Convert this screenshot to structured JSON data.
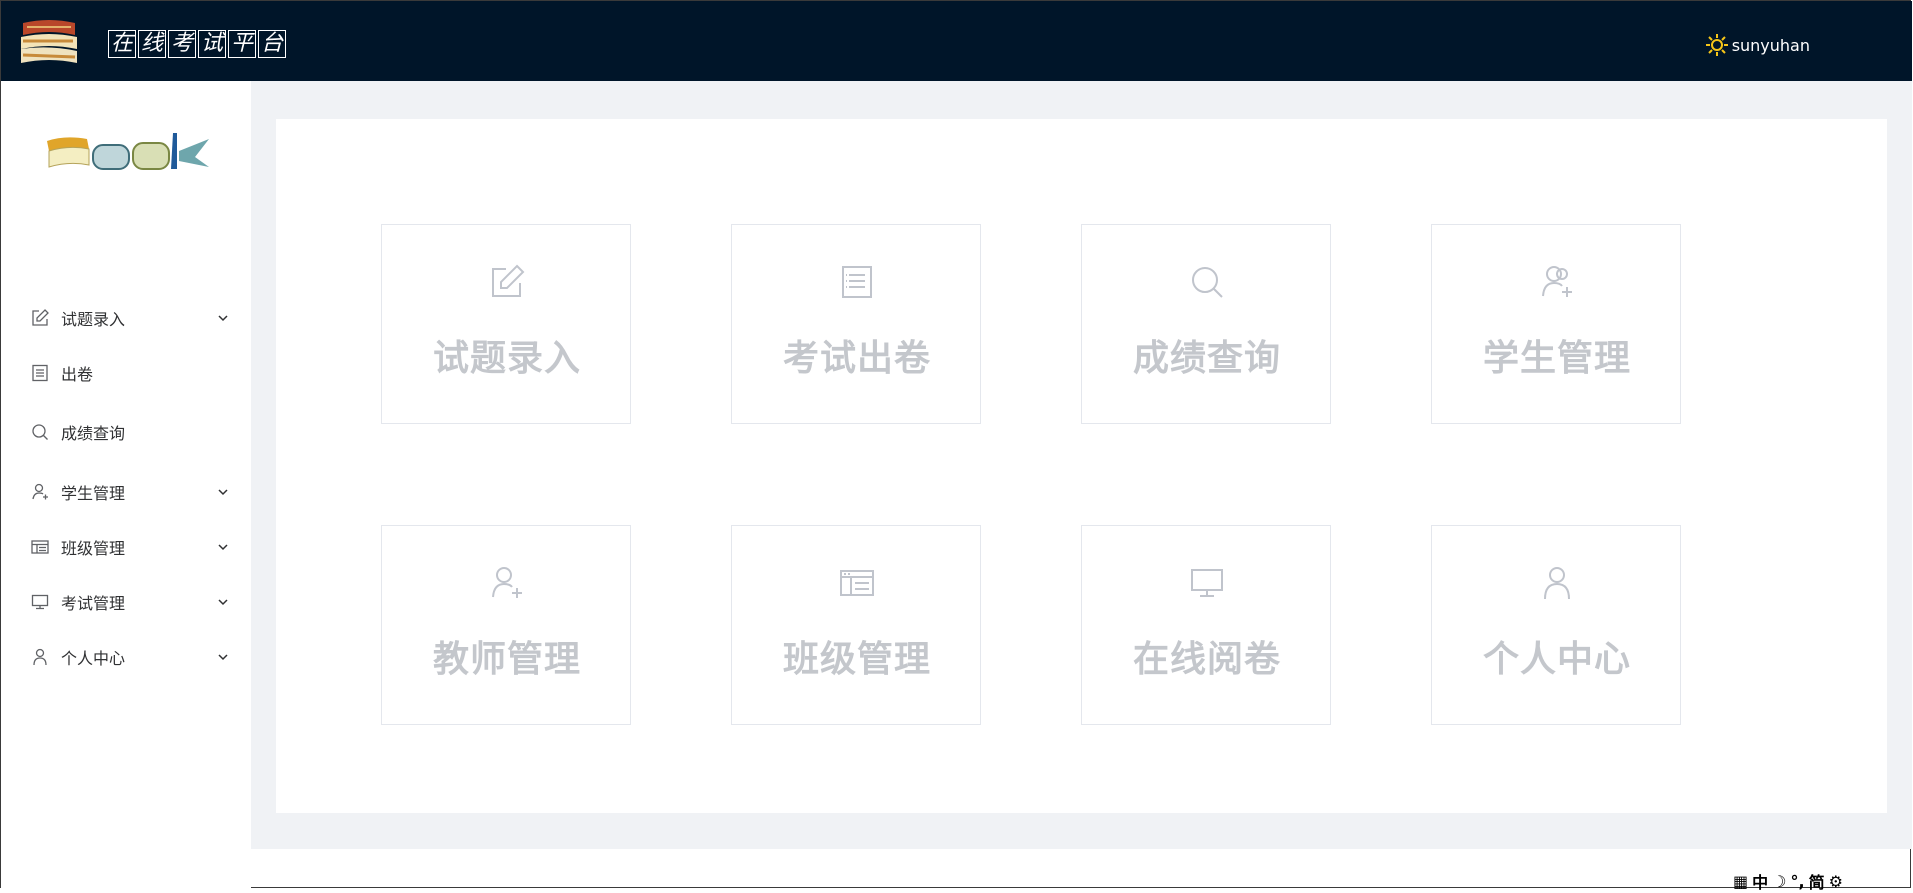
{
  "header": {
    "title_chars": [
      "在",
      "线",
      "考",
      "试",
      "平",
      "台"
    ],
    "username": "sunyuhan",
    "bg_color": "#001529"
  },
  "sidebar": {
    "items": [
      {
        "label": "试题录入",
        "icon": "edit-icon",
        "has_arrow": true
      },
      {
        "label": "出卷",
        "icon": "document-icon",
        "has_arrow": false
      },
      {
        "label": "成绩查询",
        "icon": "search-icon",
        "has_arrow": false
      },
      {
        "label": "学生管理",
        "icon": "user-add-icon",
        "has_arrow": true
      },
      {
        "label": "班级管理",
        "icon": "table-icon",
        "has_arrow": true
      },
      {
        "label": "考试管理",
        "icon": "monitor-icon",
        "has_arrow": true
      },
      {
        "label": "个人中心",
        "icon": "user-icon",
        "has_arrow": true
      }
    ]
  },
  "cards": [
    {
      "label": "试题录入",
      "icon": "edit-icon"
    },
    {
      "label": "考试出卷",
      "icon": "document-icon"
    },
    {
      "label": "成绩查询",
      "icon": "search-icon"
    },
    {
      "label": "学生管理",
      "icon": "user-add-icon"
    },
    {
      "label": "教师管理",
      "icon": "user-add-icon"
    },
    {
      "label": "班级管理",
      "icon": "table-icon"
    },
    {
      "label": "在线阅卷",
      "icon": "monitor-icon"
    },
    {
      "label": "个人中心",
      "icon": "user-icon"
    }
  ],
  "ime": {
    "mode": "中",
    "charset": "简"
  }
}
